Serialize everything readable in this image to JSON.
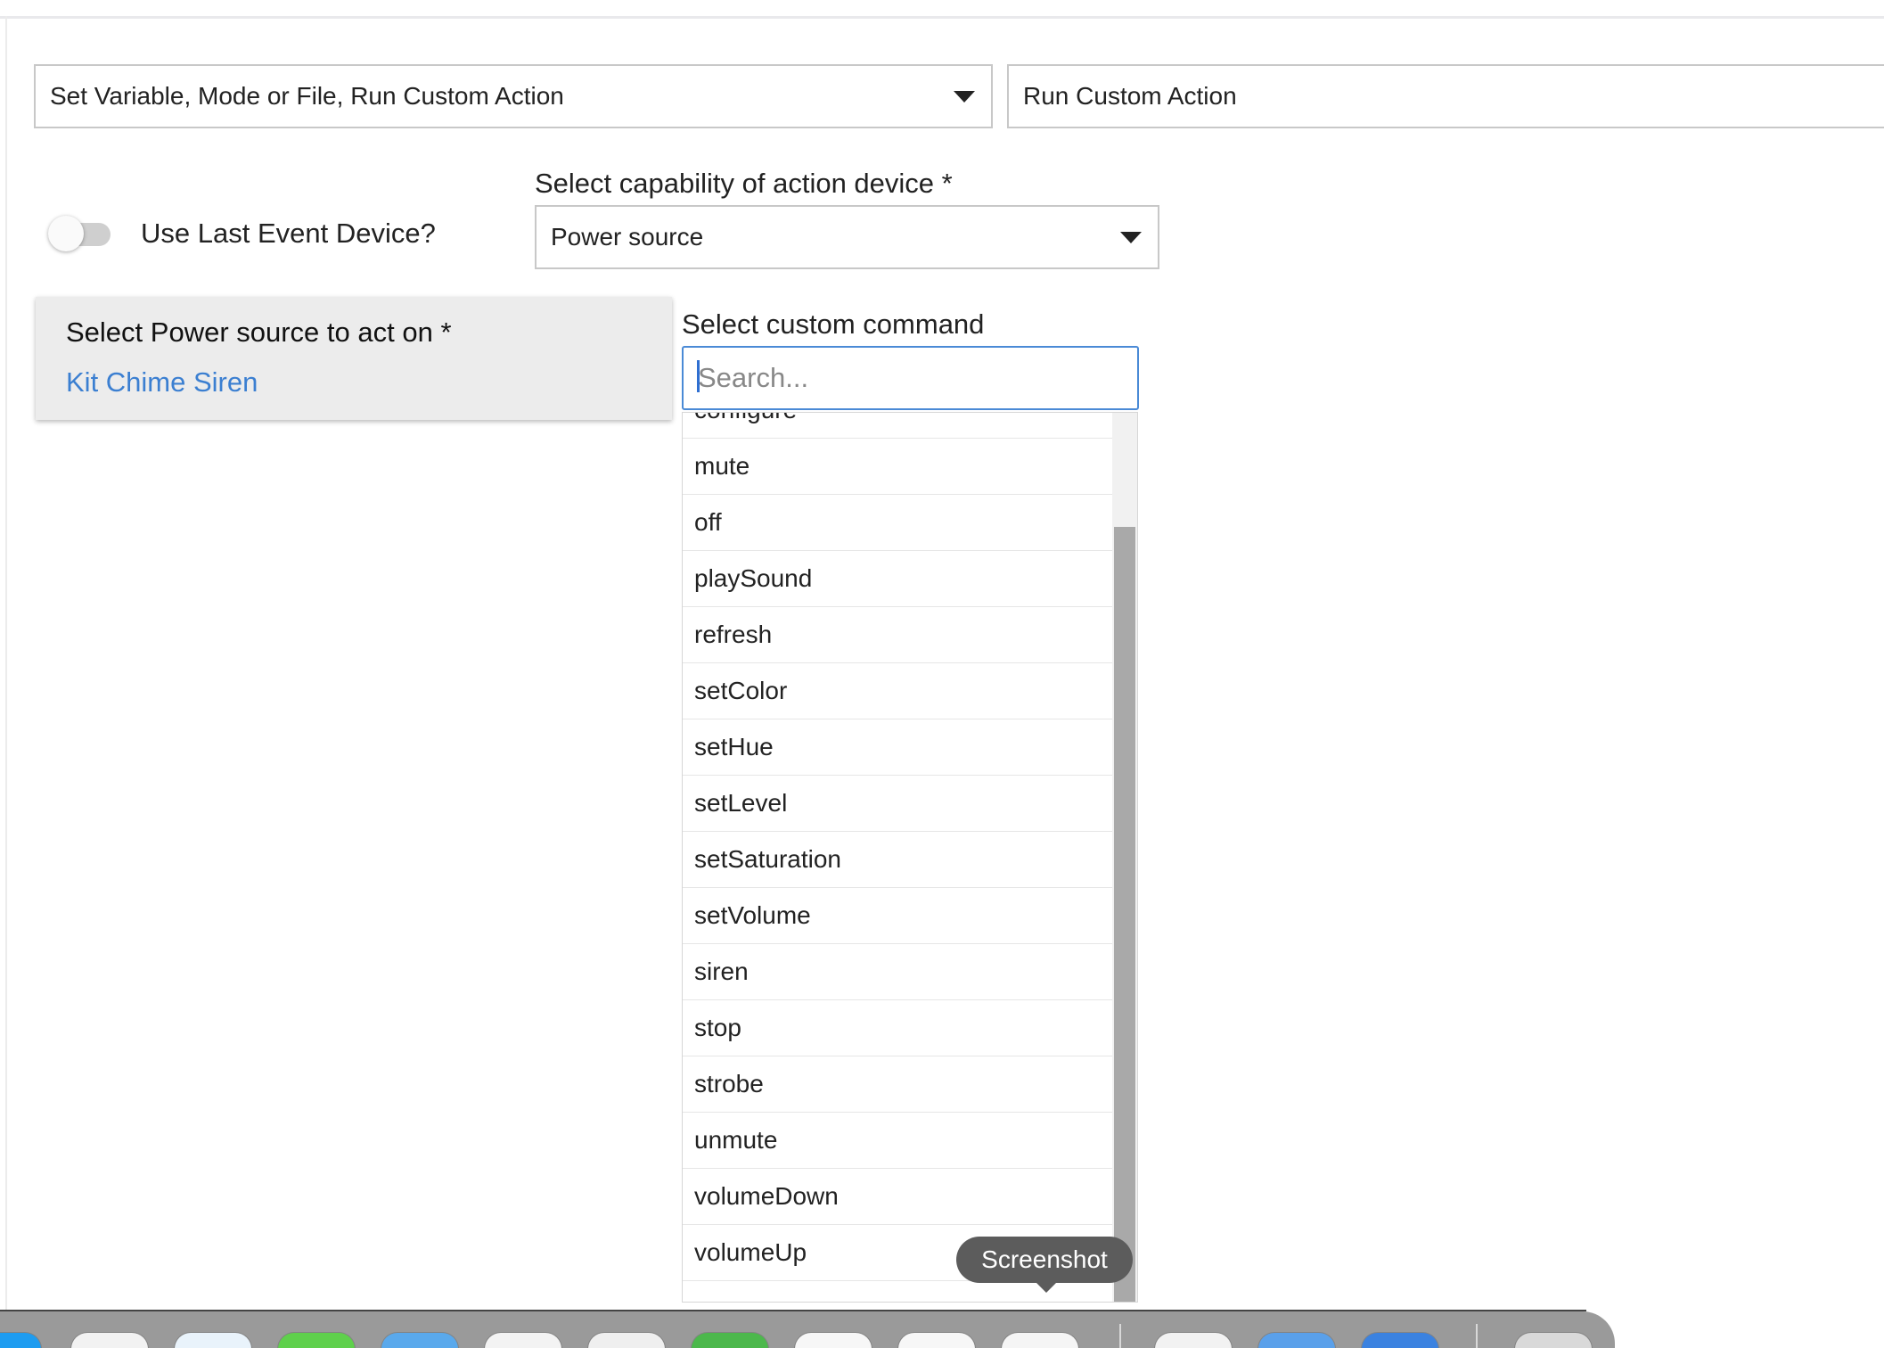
{
  "action": {
    "type_selected": "Set Variable, Mode or File, Run Custom Action",
    "action_selected": "Run Custom Action"
  },
  "toggle": {
    "label": "Use Last Event Device?",
    "on": false
  },
  "capability": {
    "label": "Select capability of action device *",
    "selected": "Power source"
  },
  "device_panel": {
    "title": "Select Power source to act on *",
    "device": "Kit Chime Siren"
  },
  "custom_command": {
    "label": "Select custom command",
    "search_placeholder": "Search...",
    "options": [
      "configure",
      "mute",
      "off",
      "playSound",
      "refresh",
      "setColor",
      "setHue",
      "setLevel",
      "setSaturation",
      "setVolume",
      "siren",
      "stop",
      "strobe",
      "unmute",
      "volumeDown",
      "volumeUp"
    ]
  },
  "tooltip": {
    "text": "Screenshot"
  },
  "dock": {
    "icons": [
      {
        "name": "finder-icon",
        "color": "#1e9cf0"
      },
      {
        "name": "launchpad-icon",
        "color": "#f2f2f2"
      },
      {
        "name": "safari-icon",
        "color": "#e9f3fb"
      },
      {
        "name": "messages-icon",
        "color": "#5fd04c"
      },
      {
        "name": "mail-icon",
        "color": "#5aa9ec"
      },
      {
        "name": "photos-icon",
        "color": "#f3f3f3"
      },
      {
        "name": "contacts-icon",
        "color": "#efefef"
      },
      {
        "name": "maps-icon",
        "color": "#4cb84c"
      },
      {
        "name": "reminders-icon",
        "color": "#f7f7f7"
      },
      {
        "name": "calendar-icon",
        "color": "#f7f7f7"
      },
      {
        "name": "notes-icon",
        "color": "#f5f5f5"
      },
      {
        "name": "preview-icon",
        "color": "#f2f2f2"
      },
      {
        "name": "app-store-icon",
        "color": "#5aa0ea"
      },
      {
        "name": "system-preferences-icon",
        "color": "#3b82e0"
      },
      {
        "name": "trash-icon",
        "color": "#d9d9d9"
      }
    ]
  }
}
